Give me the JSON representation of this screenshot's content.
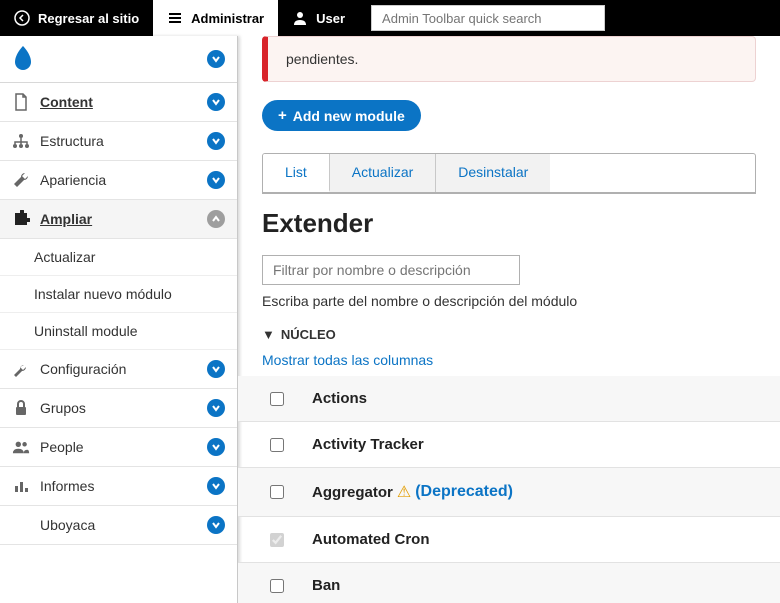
{
  "toolbar": {
    "back": "Regresar al sitio",
    "manage": "Administrar",
    "user": "User",
    "search_placeholder": "Admin Toolbar quick search"
  },
  "sidebar": {
    "items": [
      {
        "label": "Content"
      },
      {
        "label": "Estructura"
      },
      {
        "label": "Apariencia"
      },
      {
        "label": "Ampliar"
      },
      {
        "label": "Configuración"
      },
      {
        "label": "Grupos"
      },
      {
        "label": "People"
      },
      {
        "label": "Informes"
      },
      {
        "label": "Uboyaca"
      }
    ],
    "sub": {
      "actualizar": "Actualizar",
      "instalar": "Instalar nuevo módulo",
      "uninstall": "Uninstall module"
    }
  },
  "alert": {
    "text": "pendientes."
  },
  "buttons": {
    "add_module": "Add new module"
  },
  "tabs": {
    "list": "List",
    "actualizar": "Actualizar",
    "desinstalar": "Desinstalar"
  },
  "page": {
    "title": "Extender",
    "filter_placeholder": "Filtrar por nombre o descripción",
    "filter_help": "Escriba parte del nombre o descripción del módulo",
    "section": "NÚCLEO",
    "show_all": "Mostrar todas las columnas"
  },
  "modules": [
    {
      "name": "Actions",
      "checked": false,
      "disabled": false,
      "deprecated": false
    },
    {
      "name": "Activity Tracker",
      "checked": false,
      "disabled": false,
      "deprecated": false
    },
    {
      "name": "Aggregator",
      "checked": false,
      "disabled": false,
      "deprecated": true,
      "dep_label": "(Deprecated)"
    },
    {
      "name": "Automated Cron",
      "checked": true,
      "disabled": true,
      "deprecated": false
    },
    {
      "name": "Ban",
      "checked": false,
      "disabled": false,
      "deprecated": false
    }
  ]
}
